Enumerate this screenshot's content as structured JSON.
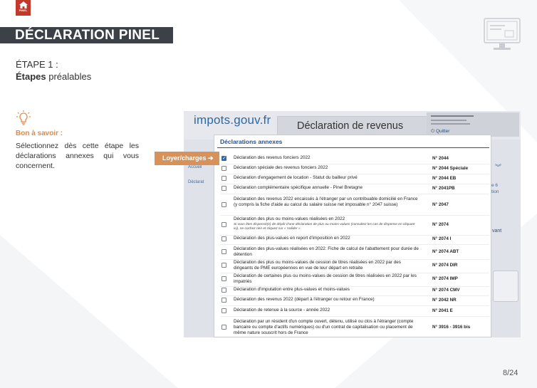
{
  "logo": {
    "icon": "house-icon",
    "text": "PINEL"
  },
  "header": {
    "title": "DÉCLARATION PINEL"
  },
  "step": {
    "label": "ÉTAPE 1 :",
    "sub_bold": "Étapes",
    "sub_rest": " préalables"
  },
  "tip": {
    "title": "Bon à savoir :",
    "text": "Sélectionnez dès cette étape les déclarations annexes qui vous concernent."
  },
  "callout": {
    "label": "Loyer/charges ➔"
  },
  "page": {
    "number": "8/24"
  },
  "colors": {
    "accent": "#d9915a",
    "title_bg": "#3c4148",
    "link_blue": "#2a4f8a"
  },
  "screenshot": {
    "site_logo": "impots.gouv.fr",
    "page_title": "Déclaration de revenus",
    "quit_label": "⏻ Quitter",
    "nav_items": [
      "Accueil",
      "Déclarat"
    ],
    "right_fragments": [
      "e 6",
      "tion",
      "vant"
    ],
    "modal": {
      "title": "Déclarations annexes",
      "rows": [
        {
          "label": "Déclaration des revenus fonciers 2022",
          "note": "",
          "code": "N° 2044",
          "checked": true
        },
        {
          "label": "Déclaration spéciale des revenus fonciers 2022",
          "note": "",
          "code": "N° 2044 Spéciale",
          "checked": false
        },
        {
          "label": "Déclaration d'engagement de location - Statut du bailleur privé",
          "note": "",
          "code": "N° 2044 EB",
          "checked": false
        },
        {
          "label": "Déclaration complémentaire spécifique annuelle - Pinel Bretagne",
          "note": "",
          "code": "N° 2041PB",
          "checked": false
        },
        {
          "label": "Déclaration des revenus 2022 encaissés à l'étranger par un contribuable domicilié en France (y compris la fiche d'aide au calcul du salaire suisse net imposable n° 2047 suisse)",
          "note": "",
          "code": "N° 2047",
          "checked": false
        },
        {
          "label": "Déclaration des plus ou moins-values réalisées en 2022",
          "note": "Si vous êtes dispensé(e) de dépôt d'une déclaration de plus ou moins-values (consultez les cas de dispense en cliquant ici), ne cochez rien et cliquez sur « Valider »",
          "code": "N° 2074",
          "checked": false
        },
        {
          "label": "Déclaration des plus-values en report d'imposition en 2022",
          "note": "",
          "code": "N° 2074 I",
          "checked": false
        },
        {
          "label": "Déclaration des plus-values réalisées en 2022: Fiche de calcul de l'abattement pour durée de détention",
          "note": "",
          "code": "N° 2074 ABT",
          "checked": false
        },
        {
          "label": "Déclaration des plus ou moins-values de cession de titres réalisées en 2022 par des dirigeants de PME européennes en vue de leur départ en retraite",
          "note": "",
          "code": "N° 2074 DIR",
          "checked": false
        },
        {
          "label": "Déclaration de certaines plus ou moins-values de cession de titres réalisées en 2022 par les impatriés",
          "note": "",
          "code": "N° 2074 IMP",
          "checked": false
        },
        {
          "label": "Déclaration d'imputation entre plus-values et moins-values",
          "note": "",
          "code": "N° 2074 CMV",
          "checked": false
        },
        {
          "label": "Déclaration des revenus 2022 (départ à l'étranger ou retour en France)",
          "note": "",
          "code": "N° 2042 NR",
          "checked": false
        },
        {
          "label": "Déclaration de retenue à la source - année 2022",
          "note": "",
          "code": "N° 2041 E",
          "checked": false
        },
        {
          "label": "Déclaration par un résident d'un compte ouvert, détenu, utilisé ou clos à l'étranger (compte bancaire ou compte d'actifs numériques) ou d'un contrat de capitalisation ou placement de même nature souscrit hors de France",
          "note": "",
          "code": "N° 3916 - 3916 bis",
          "checked": false
        }
      ]
    }
  }
}
